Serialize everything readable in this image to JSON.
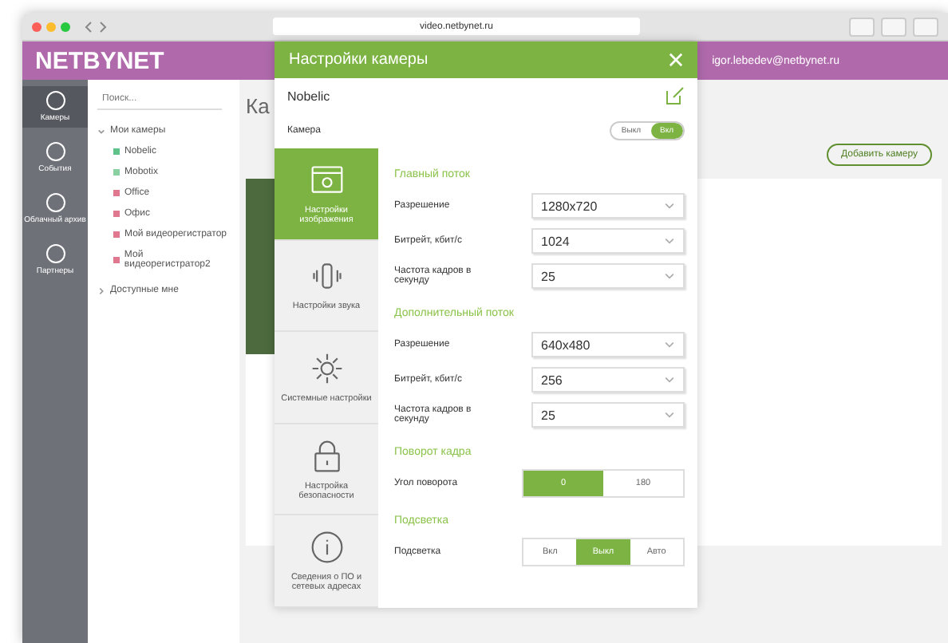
{
  "browser": {
    "url": "video.netbynet.ru"
  },
  "app": {
    "logo": "NETBYNET",
    "user": "igor.lebedev@netbynet.ru",
    "search": {
      "placeholder": "Поиск..."
    },
    "page_title": "Ка",
    "rail": [
      {
        "label": "Камеры",
        "selected": true
      },
      {
        "label": "События",
        "selected": false
      },
      {
        "label": "Облачный архив",
        "selected": false
      },
      {
        "label": "Партнеры",
        "selected": false
      }
    ],
    "tree": [
      {
        "label": "Мои камеры",
        "expanded": true,
        "children": [
          {
            "label": "Nobelic",
            "color": "#5fc28a"
          },
          {
            "label": "Mobotix",
            "color": "#8ad0a0"
          },
          {
            "label": "Office",
            "color": "#e07890"
          },
          {
            "label": "Офис",
            "color": "#e07890"
          },
          {
            "label": "Мой видеорегистратор",
            "color": "#e07890"
          },
          {
            "label": "Мой видеорегистратор2",
            "color": "#e07890"
          }
        ]
      },
      {
        "label": "Доступные мне",
        "expanded": false
      }
    ],
    "add_button": "Добавить камеру"
  },
  "dialog": {
    "title": "Настройки камеры",
    "camera_name": "Nobelic",
    "camera_label": "Камера",
    "power": [
      {
        "label": "Выкл",
        "selected": false
      },
      {
        "label": "Вкл",
        "selected": true
      }
    ],
    "tabs": [
      {
        "label": "Настройки изображения",
        "selected": true
      },
      {
        "label": "Настройки звука",
        "selected": false
      },
      {
        "label": "Системные настройки",
        "selected": false
      },
      {
        "label": "Настройка безопасности",
        "selected": false
      },
      {
        "label": "Сведения о ПО и сетевых адресах",
        "selected": false
      }
    ],
    "sections": [
      {
        "title": "Главный поток",
        "rows": [
          {
            "kind": "select",
            "label": "Разрешение",
            "value": "1280x720"
          },
          {
            "kind": "select",
            "label": "Битрейт, кбит/с",
            "value": "1024"
          },
          {
            "kind": "select",
            "label": "Частота кадров в секунду",
            "value": "25"
          }
        ]
      },
      {
        "title": "Дополнительный поток",
        "rows": [
          {
            "kind": "select",
            "label": "Разрешение",
            "value": "640x480"
          },
          {
            "kind": "select",
            "label": "Битрейт, кбит/с",
            "value": "256"
          },
          {
            "kind": "select",
            "label": "Частота кадров в секунду",
            "value": "25"
          }
        ]
      },
      {
        "title": "Поворот кадра",
        "rows": [
          {
            "kind": "segmented",
            "label": "Угол поворота",
            "options": [
              {
                "label": "0",
                "selected": true
              },
              {
                "label": "180",
                "selected": false
              }
            ]
          }
        ]
      },
      {
        "title": "Подсветка",
        "rows": [
          {
            "kind": "segmented",
            "label": "Подсветка",
            "options": [
              {
                "label": "Вкл",
                "selected": false
              },
              {
                "label": "Выкл",
                "selected": true
              },
              {
                "label": "Авто",
                "selected": false
              }
            ]
          }
        ]
      }
    ]
  }
}
